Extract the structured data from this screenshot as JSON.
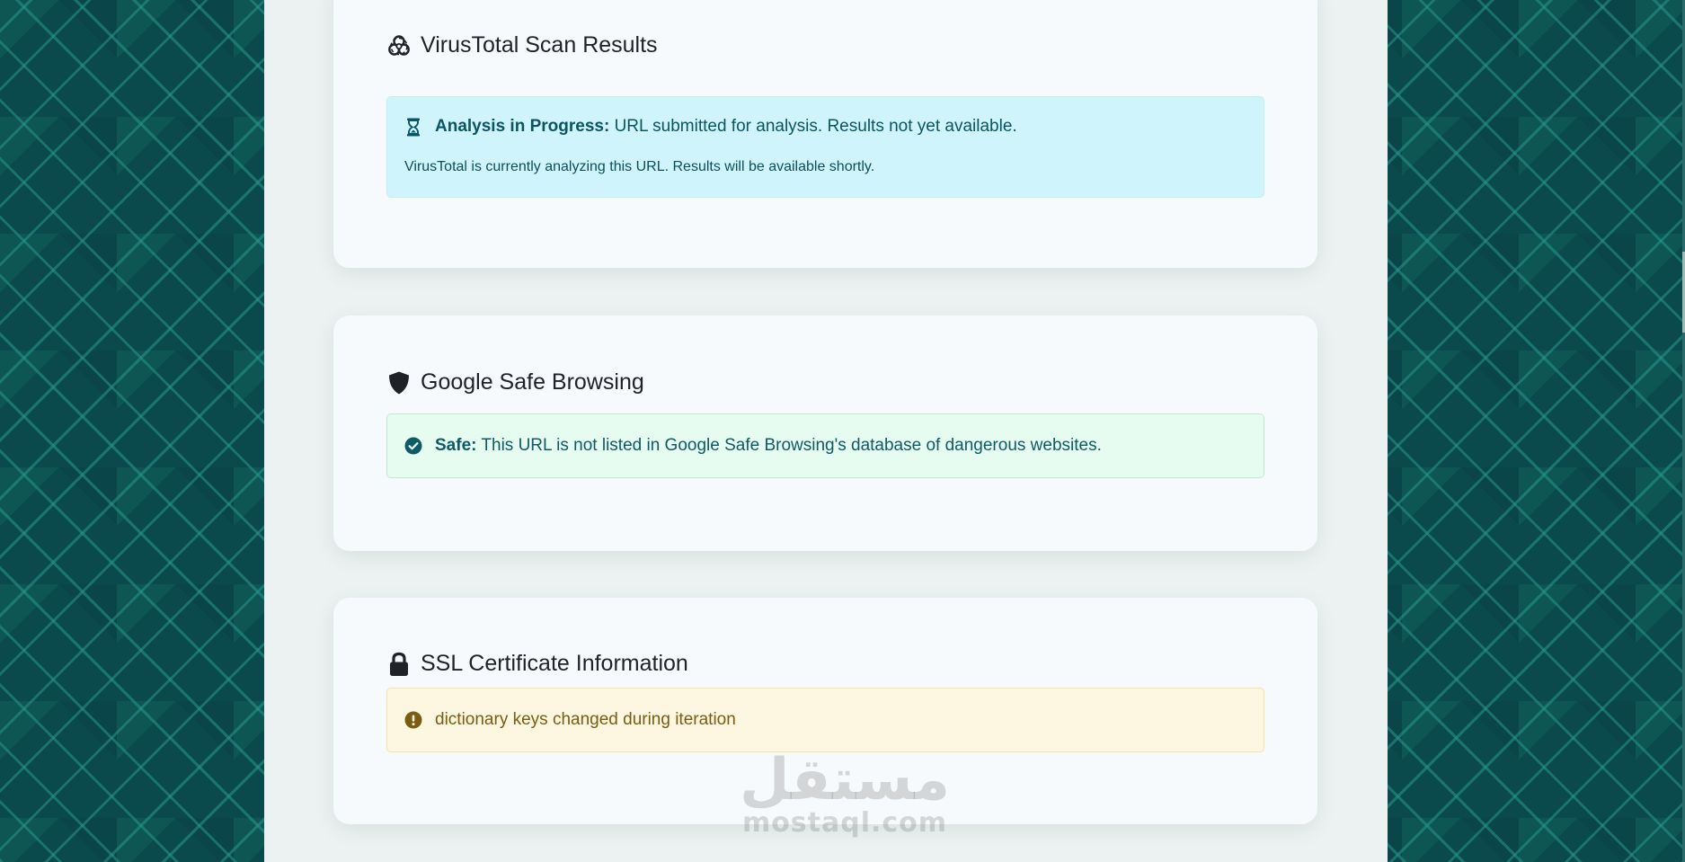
{
  "virustotal": {
    "title": "VirusTotal Scan Results",
    "title_icon": "biohazard-icon",
    "alert": {
      "icon": "hourglass-icon",
      "label": "Analysis in Progress:",
      "message": " URL submitted for analysis. Results not yet available.",
      "detail": "VirusTotal is currently analyzing this URL. Results will be available shortly.",
      "bg_color": "#cff4fc",
      "text_color": "#0b5563"
    }
  },
  "safe_browsing": {
    "title": "Google Safe Browsing",
    "title_icon": "shield-icon",
    "alert": {
      "icon": "check-circle-icon",
      "label": "Safe:",
      "message": " This URL is not listed in Google Safe Browsing's database of dangerous websites.",
      "bg_color": "#e6fcf1",
      "text_color": "#0f5a63"
    }
  },
  "ssl": {
    "title": "SSL Certificate Information",
    "title_icon": "lock-icon",
    "alert": {
      "icon": "exclamation-circle-icon",
      "message": "dictionary keys changed during iteration",
      "bg_color": "#fdf6e0",
      "text_color": "#7a5d12"
    }
  },
  "watermark": {
    "arabic": "مستقل",
    "latin": "mostaql.com"
  },
  "colors": {
    "page_background": "#0b4a4c",
    "column_background": "#ecf2f1",
    "card_background": "#f7fafc"
  }
}
